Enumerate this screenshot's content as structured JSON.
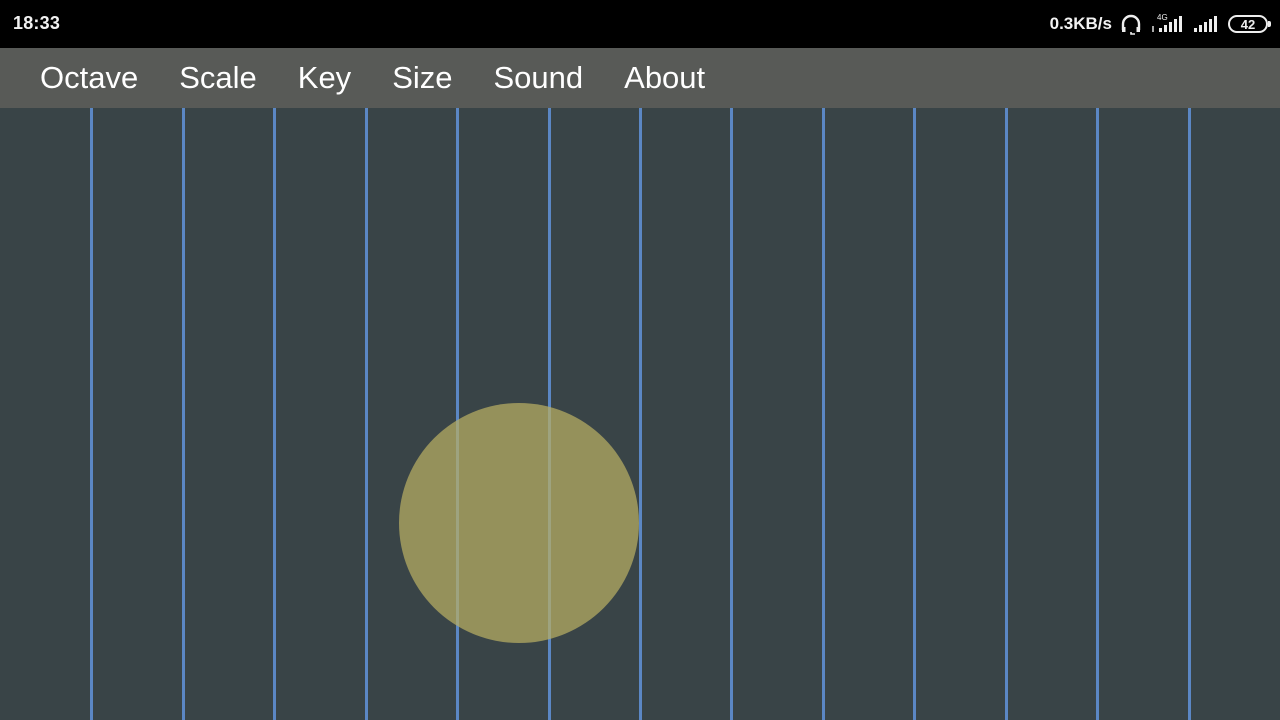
{
  "status_bar": {
    "time": "18:33",
    "net_speed": "0.3KB/s",
    "icons": [
      "headphones-icon",
      "signal-4g-icon",
      "signal-icon"
    ],
    "network_type": "4G",
    "battery_level": "42"
  },
  "menu": {
    "items": [
      {
        "label": "Octave"
      },
      {
        "label": "Scale"
      },
      {
        "label": "Key"
      },
      {
        "label": "Size"
      },
      {
        "label": "Sound"
      },
      {
        "label": "About"
      }
    ]
  },
  "stage": {
    "string_count": 13,
    "string_color": "#5b87c4",
    "background_color": "#394447",
    "touch_color": "#b8af64",
    "touch_active": true
  }
}
